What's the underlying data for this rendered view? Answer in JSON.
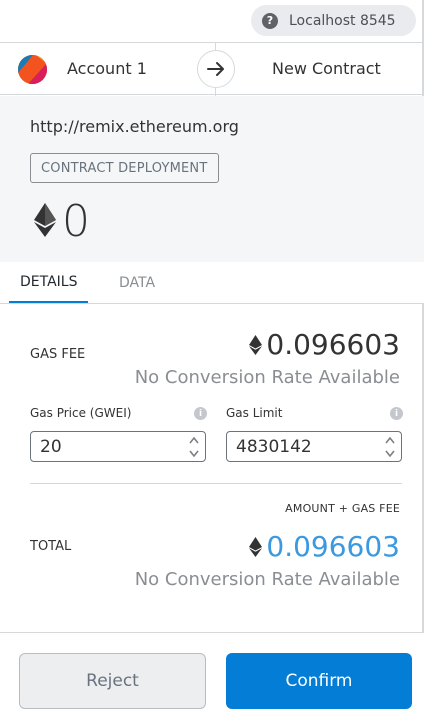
{
  "network": {
    "label": "Localhost 8545",
    "icon": "question-icon"
  },
  "header": {
    "account_name": "Account 1",
    "contract_label": "New Contract",
    "arrow_icon": "arrow-right-icon"
  },
  "origin": {
    "url": "http://remix.ethereum.org",
    "badge": "CONTRACT DEPLOYMENT",
    "amount": "0",
    "currency_icon": "ethereum-icon"
  },
  "tabs": [
    {
      "label": "DETAILS",
      "active": true
    },
    {
      "label": "DATA",
      "active": false
    }
  ],
  "details": {
    "gas_fee_label": "GAS FEE",
    "gas_fee_value": "0.096603",
    "gas_fee_conversion": "No Conversion Rate Available",
    "gas_price_label": "Gas Price (GWEI)",
    "gas_price_value": "20",
    "gas_limit_label": "Gas Limit",
    "gas_limit_value": "4830142",
    "total_caption": "AMOUNT + GAS FEE",
    "total_label": "TOTAL",
    "total_value": "0.096603",
    "total_conversion": "No Conversion Rate Available"
  },
  "footer": {
    "reject_label": "Reject",
    "confirm_label": "Confirm"
  },
  "colors": {
    "accent": "#037dd6",
    "total_value": "#3b99e0",
    "muted": "#8a8e93"
  }
}
